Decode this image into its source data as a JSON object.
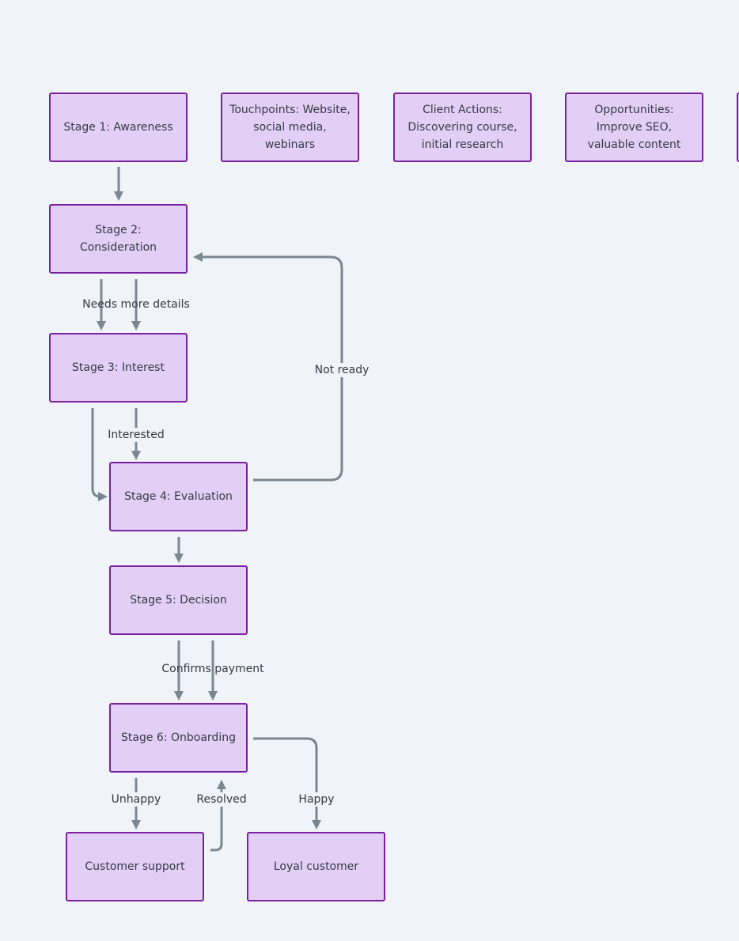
{
  "diagram": {
    "type": "flowchart",
    "colors": {
      "background": "#f0f3f7",
      "node_fill": "#e3cff5",
      "node_border": "#7b1fa2",
      "edge": "#7a8793",
      "text": "#333a45"
    },
    "nodes": [
      {
        "id": "stage1",
        "label": "Stage 1: Awareness"
      },
      {
        "id": "touchpoints",
        "label": "Touchpoints: Website,\nsocial media,\nwebinars"
      },
      {
        "id": "client_actions",
        "label": "Client Actions:\nDiscovering course,\ninitial research"
      },
      {
        "id": "opportunities",
        "label": "Opportunities:\nImprove SEO,\nvaluable content"
      },
      {
        "id": "partial_node",
        "label": ""
      },
      {
        "id": "stage2",
        "label": "Stage 2:\nConsideration"
      },
      {
        "id": "stage3",
        "label": "Stage 3: Interest"
      },
      {
        "id": "stage4",
        "label": "Stage 4: Evaluation"
      },
      {
        "id": "stage5",
        "label": "Stage 5: Decision"
      },
      {
        "id": "stage6",
        "label": "Stage 6: Onboarding"
      },
      {
        "id": "support",
        "label": "Customer support"
      },
      {
        "id": "loyal",
        "label": "Loyal customer"
      }
    ],
    "edges": [
      {
        "from": "stage1",
        "to": "stage2",
        "label": ""
      },
      {
        "from": "stage2",
        "to": "stage3",
        "label": ""
      },
      {
        "from": "stage2",
        "to": "stage3",
        "label": "Needs more details"
      },
      {
        "from": "stage3",
        "to": "stage4",
        "label": ""
      },
      {
        "from": "stage3",
        "to": "stage4",
        "label": "Interested"
      },
      {
        "from": "stage4",
        "to": "stage2",
        "label": "Not ready"
      },
      {
        "from": "stage4",
        "to": "stage5",
        "label": ""
      },
      {
        "from": "stage5",
        "to": "stage6",
        "label": ""
      },
      {
        "from": "stage5",
        "to": "stage6",
        "label": "Confirms payment"
      },
      {
        "from": "stage6",
        "to": "support",
        "label": "Unhappy"
      },
      {
        "from": "support",
        "to": "stage6",
        "label": "Resolved"
      },
      {
        "from": "stage6",
        "to": "loyal",
        "label": "Happy"
      }
    ]
  }
}
